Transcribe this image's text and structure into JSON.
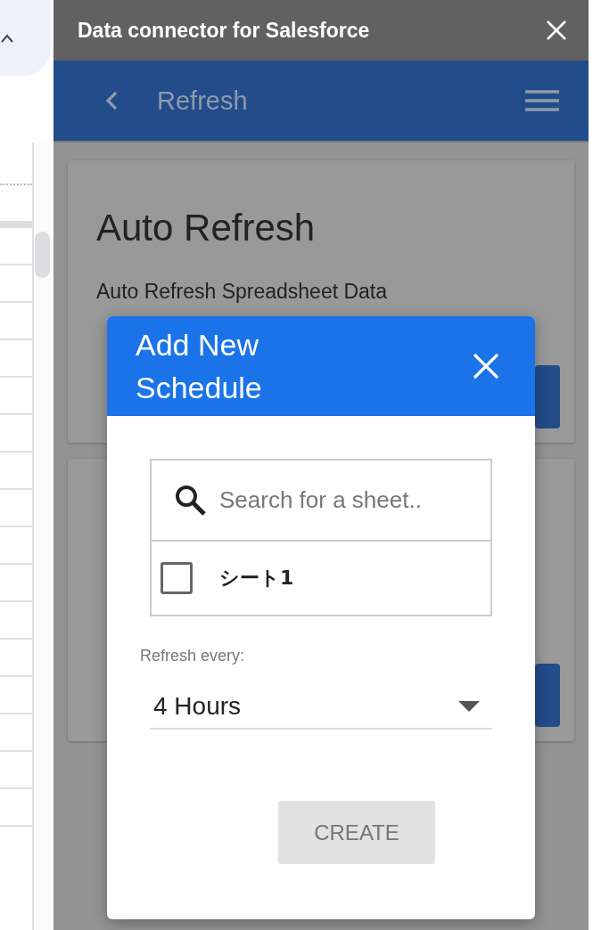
{
  "window": {
    "title": "Data connector for Salesforce"
  },
  "toolbar": {
    "title": "Refresh"
  },
  "cards": [
    {
      "kind": "text",
      "title": "Auto Refresh",
      "subtitle": "Auto Refresh Spreadsheet Data"
    },
    {
      "kind": "covered"
    }
  ],
  "dialog": {
    "title": "Add New Schedule",
    "search": {
      "placeholder": "Search for a sheet.."
    },
    "sheets": [
      {
        "label": "シート1",
        "checked": false
      }
    ],
    "interval_label": "Refresh every:",
    "interval": "4 Hours",
    "create_button": {
      "label": "CREATE",
      "disabled": true
    }
  }
}
